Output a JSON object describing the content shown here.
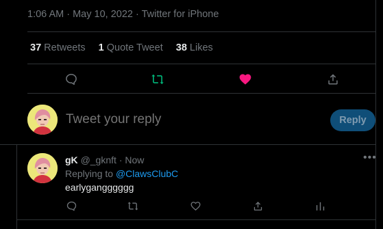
{
  "tweet": {
    "timestamp": "1:06 AM · May 10, 2022 · Twitter for iPhone",
    "stats": [
      {
        "count": "37",
        "label": "Retweets"
      },
      {
        "count": "1",
        "label": "Quote Tweet"
      },
      {
        "count": "38",
        "label": "Likes"
      }
    ],
    "actions": {
      "reply_icon": "comment-icon",
      "retweet_icon": "retweet-icon",
      "like_icon": "heart-filled-icon",
      "share_icon": "share-icon"
    },
    "colors": {
      "retweet_active": "#00ba7c",
      "like_active": "#f91880",
      "accent": "#1d9bf0"
    }
  },
  "composer": {
    "placeholder": "Tweet your reply",
    "button_label": "Reply"
  },
  "reply": {
    "name": "gK",
    "handle": "@_gknft",
    "separator": "·",
    "time": "Now",
    "replying_prefix": "Replying to",
    "replying_to": "@ClawsClubC",
    "text": "earlygangggggg",
    "more_icon": "more-icon",
    "actions": [
      "comment-icon",
      "retweet-icon",
      "heart-icon",
      "share-icon",
      "analytics-icon"
    ]
  }
}
